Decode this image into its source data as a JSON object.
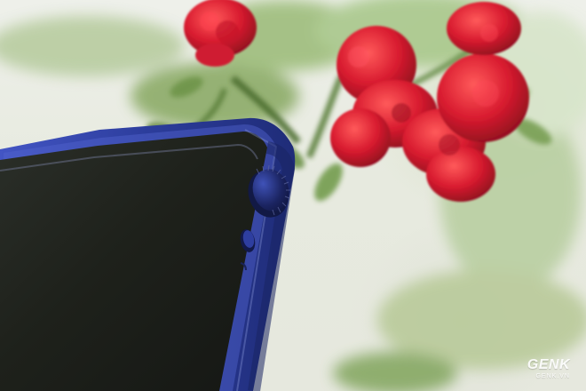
{
  "watermark": {
    "brand": "GENK",
    "site": "GENK.VN"
  },
  "colors": {
    "background_cream": "#e8ebe0",
    "foliage_green": "#9fbc75",
    "rose_red": "#d61d2e",
    "device_blue": "#2b3b9a",
    "screen_black": "#1a1d17"
  }
}
